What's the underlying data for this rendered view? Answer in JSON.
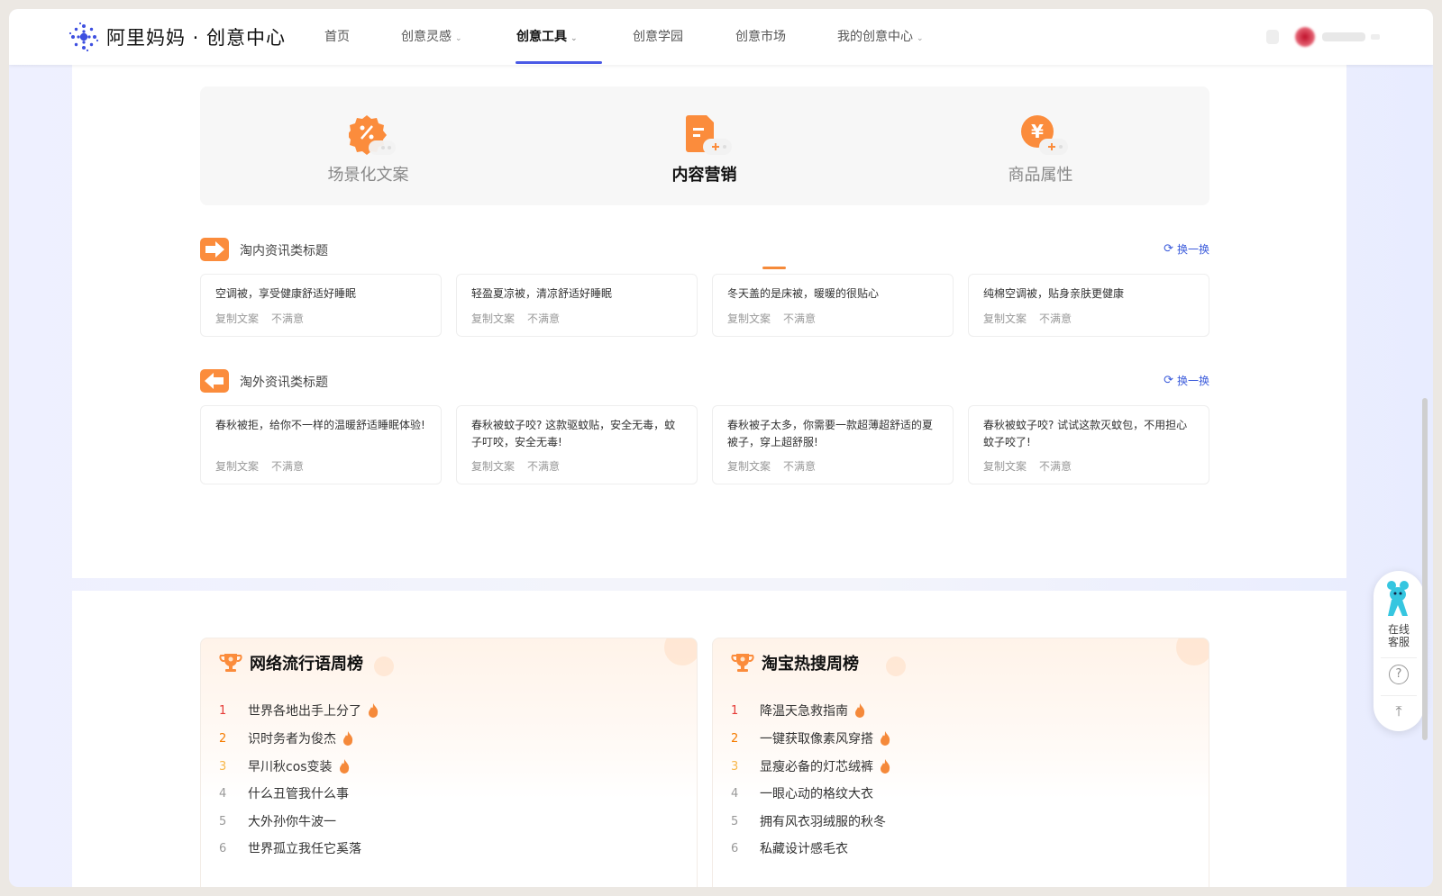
{
  "header": {
    "brand": "阿里妈妈 · 创意中心",
    "nav": [
      {
        "label": "首页",
        "chevron": false,
        "active": false
      },
      {
        "label": "创意灵感",
        "chevron": true,
        "active": false
      },
      {
        "label": "创意工具",
        "chevron": true,
        "active": true
      },
      {
        "label": "创意学园",
        "chevron": false,
        "active": false
      },
      {
        "label": "创意市场",
        "chevron": false,
        "active": false
      },
      {
        "label": "我的创意中心",
        "chevron": true,
        "active": false
      }
    ]
  },
  "tabs": [
    {
      "label": "场景化文案",
      "active": false
    },
    {
      "label": "内容营销",
      "active": true
    },
    {
      "label": "商品属性",
      "active": false
    }
  ],
  "sections": [
    {
      "title": "淘内资讯类标题",
      "refresh": "换一换",
      "cards": [
        {
          "text": "空调被，享受健康舒适好睡眠",
          "copy": "复制文案",
          "dislike": "不满意"
        },
        {
          "text": "轻盈夏凉被，清凉舒适好睡眠",
          "copy": "复制文案",
          "dislike": "不满意"
        },
        {
          "text": "冬天盖的是床被，暖暖的很贴心",
          "copy": "复制文案",
          "dislike": "不满意"
        },
        {
          "text": "纯棉空调被，贴身亲肤更健康",
          "copy": "复制文案",
          "dislike": "不满意"
        }
      ]
    },
    {
      "title": "淘外资讯类标题",
      "refresh": "换一换",
      "cards": [
        {
          "text": "春秋被拒，给你不一样的温暖舒适睡眠体验!",
          "copy": "复制文案",
          "dislike": "不满意"
        },
        {
          "text": "春秋被蚊子咬? 这款驱蚊贴，安全无毒，蚊子叮咬，安全无毒!",
          "copy": "复制文案",
          "dislike": "不满意"
        },
        {
          "text": "春秋被子太多，你需要一款超薄超舒适的夏被子，穿上超舒服!",
          "copy": "复制文案",
          "dislike": "不满意"
        },
        {
          "text": "春秋被蚊子咬? 试试这款灭蚊包，不用担心蚊子咬了!",
          "copy": "复制文案",
          "dislike": "不满意"
        }
      ]
    }
  ],
  "rankings": [
    {
      "title": "网络流行语周榜",
      "items": [
        {
          "rank": "1",
          "text": "世界各地出手上分了",
          "hot": true
        },
        {
          "rank": "2",
          "text": "识时务者为俊杰",
          "hot": true
        },
        {
          "rank": "3",
          "text": "早川秋cos变装",
          "hot": true
        },
        {
          "rank": "4",
          "text": "什么丑管我什么事",
          "hot": false
        },
        {
          "rank": "5",
          "text": "大外孙你牛波一",
          "hot": false
        },
        {
          "rank": "6",
          "text": "世界孤立我任它奚落",
          "hot": false
        }
      ]
    },
    {
      "title": "淘宝热搜周榜",
      "items": [
        {
          "rank": "1",
          "text": "降温天急救指南",
          "hot": true
        },
        {
          "rank": "2",
          "text": "一键获取像素风穿搭",
          "hot": true
        },
        {
          "rank": "3",
          "text": "显瘦必备的灯芯绒裤",
          "hot": true
        },
        {
          "rank": "4",
          "text": "一眼心动的格纹大衣",
          "hot": false
        },
        {
          "rank": "5",
          "text": "拥有风衣羽绒服的秋冬",
          "hot": false
        },
        {
          "rank": "6",
          "text": "私藏设计感毛衣",
          "hot": false
        }
      ]
    }
  ],
  "float": {
    "service_line1": "在线",
    "service_line2": "客服",
    "help": "?",
    "top": "⤒"
  },
  "colors": {
    "accent_orange": "#fb8c3c",
    "nav_active": "#4a5ae6",
    "link_blue": "#3b5bdb"
  }
}
